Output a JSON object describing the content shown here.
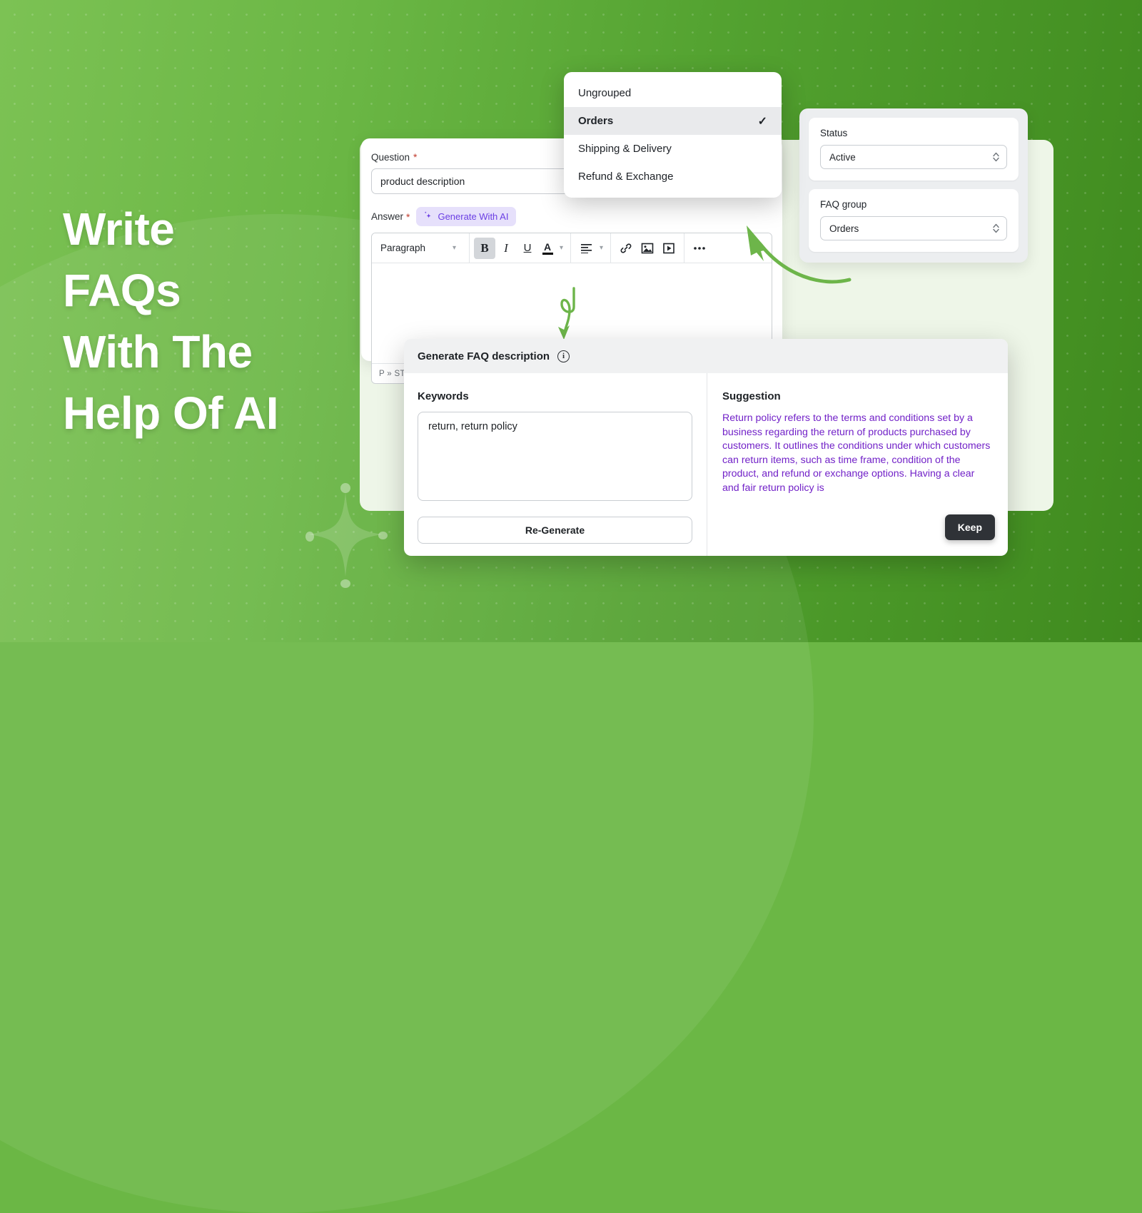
{
  "hero": {
    "headline": "Write\nFAQs\nWith The\nHelp Of AI"
  },
  "form": {
    "question_label": "Question",
    "required_mark": "*",
    "question_value": "product description",
    "question_placeholder": "Question",
    "answer_label": "Answer",
    "ai_button_label": "Generate With AI",
    "editor": {
      "style_select": "Paragraph",
      "bold_label": "B",
      "italic_label": "I",
      "underline_label": "U",
      "text_color_label": "A",
      "status_text": "P » ST",
      "body_text": ""
    }
  },
  "sidebar": {
    "status_label": "Status",
    "status_value": "Active",
    "faq_group_label": "FAQ group",
    "faq_group_value": "Orders"
  },
  "dropdown": {
    "items": [
      {
        "label": "Ungrouped",
        "selected": false
      },
      {
        "label": "Orders",
        "selected": true
      },
      {
        "label": "Shipping & Delivery",
        "selected": false
      },
      {
        "label": "Refund & Exchange",
        "selected": false
      }
    ],
    "check_glyph": "✓"
  },
  "modal": {
    "title": "Generate FAQ description",
    "info_glyph": "i",
    "keywords_label": "Keywords",
    "keywords_value": "return, return policy",
    "keywords_placeholder": "Keywords",
    "regenerate_label": "Re-Generate",
    "suggestion_label": "Suggestion",
    "suggestion_text": "Return policy refers to the terms and conditions set by a business regarding the return of products purchased by customers. It outlines the conditions under which customers can return items, such as time frame, condition of the product, and refund or exchange options. Having a clear and fair return policy is",
    "keep_label": "Keep"
  },
  "colors": {
    "brand_green": "#6bb745",
    "green_dark": "#3f8a1e",
    "mint_panel": "#eef6e8",
    "ai_purple": "#6b3fe4",
    "ai_purple_bg": "#e6e0fb",
    "suggestion_purple": "#7222c8",
    "keep_dark": "#2f3237",
    "arrow_green": "#6db54a"
  }
}
